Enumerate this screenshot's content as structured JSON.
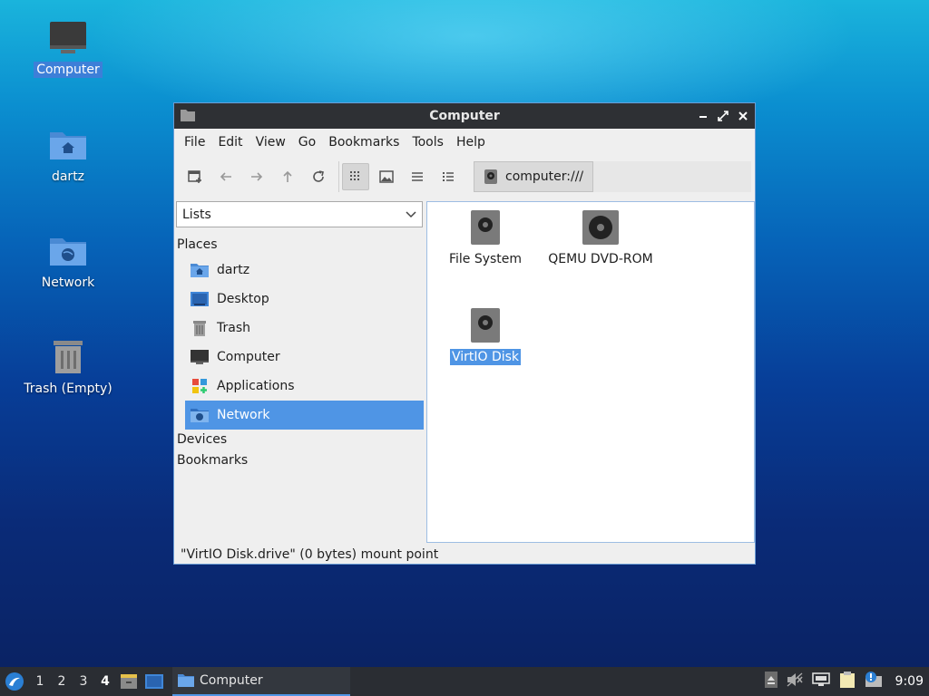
{
  "desktop": {
    "icons": [
      {
        "label": "Computer"
      },
      {
        "label": "dartz"
      },
      {
        "label": "Network"
      },
      {
        "label": "Trash (Empty)"
      }
    ]
  },
  "window": {
    "title": "Computer",
    "menu": [
      "File",
      "Edit",
      "View",
      "Go",
      "Bookmarks",
      "Tools",
      "Help"
    ],
    "location": "computer:///",
    "sidebar": {
      "mode": "Lists",
      "places_header": "Places",
      "places": [
        {
          "label": "dartz",
          "icon": "home-folder-icon"
        },
        {
          "label": "Desktop",
          "icon": "desktop-icon"
        },
        {
          "label": "Trash",
          "icon": "trash-icon"
        },
        {
          "label": "Computer",
          "icon": "computer-icon"
        },
        {
          "label": "Applications",
          "icon": "applications-icon"
        },
        {
          "label": "Network",
          "icon": "network-icon"
        }
      ],
      "devices_header": "Devices",
      "bookmarks_header": "Bookmarks"
    },
    "items": [
      {
        "label": "File System",
        "icon": "harddisk-icon"
      },
      {
        "label": "QEMU DVD-ROM",
        "icon": "optical-drive-icon"
      },
      {
        "label": "VirtIO Disk",
        "icon": "harddisk-icon"
      }
    ],
    "status": "\"VirtIO Disk.drive\" (0 bytes) mount point"
  },
  "taskbar": {
    "workspaces": [
      "1",
      "2",
      "3",
      "4"
    ],
    "current_workspace": "4",
    "task_label": "Computer",
    "clock": "9:09"
  },
  "colors": {
    "selection": "#4f95e5",
    "titlebar": "#2e3034",
    "taskbar": "#2a2d33"
  }
}
